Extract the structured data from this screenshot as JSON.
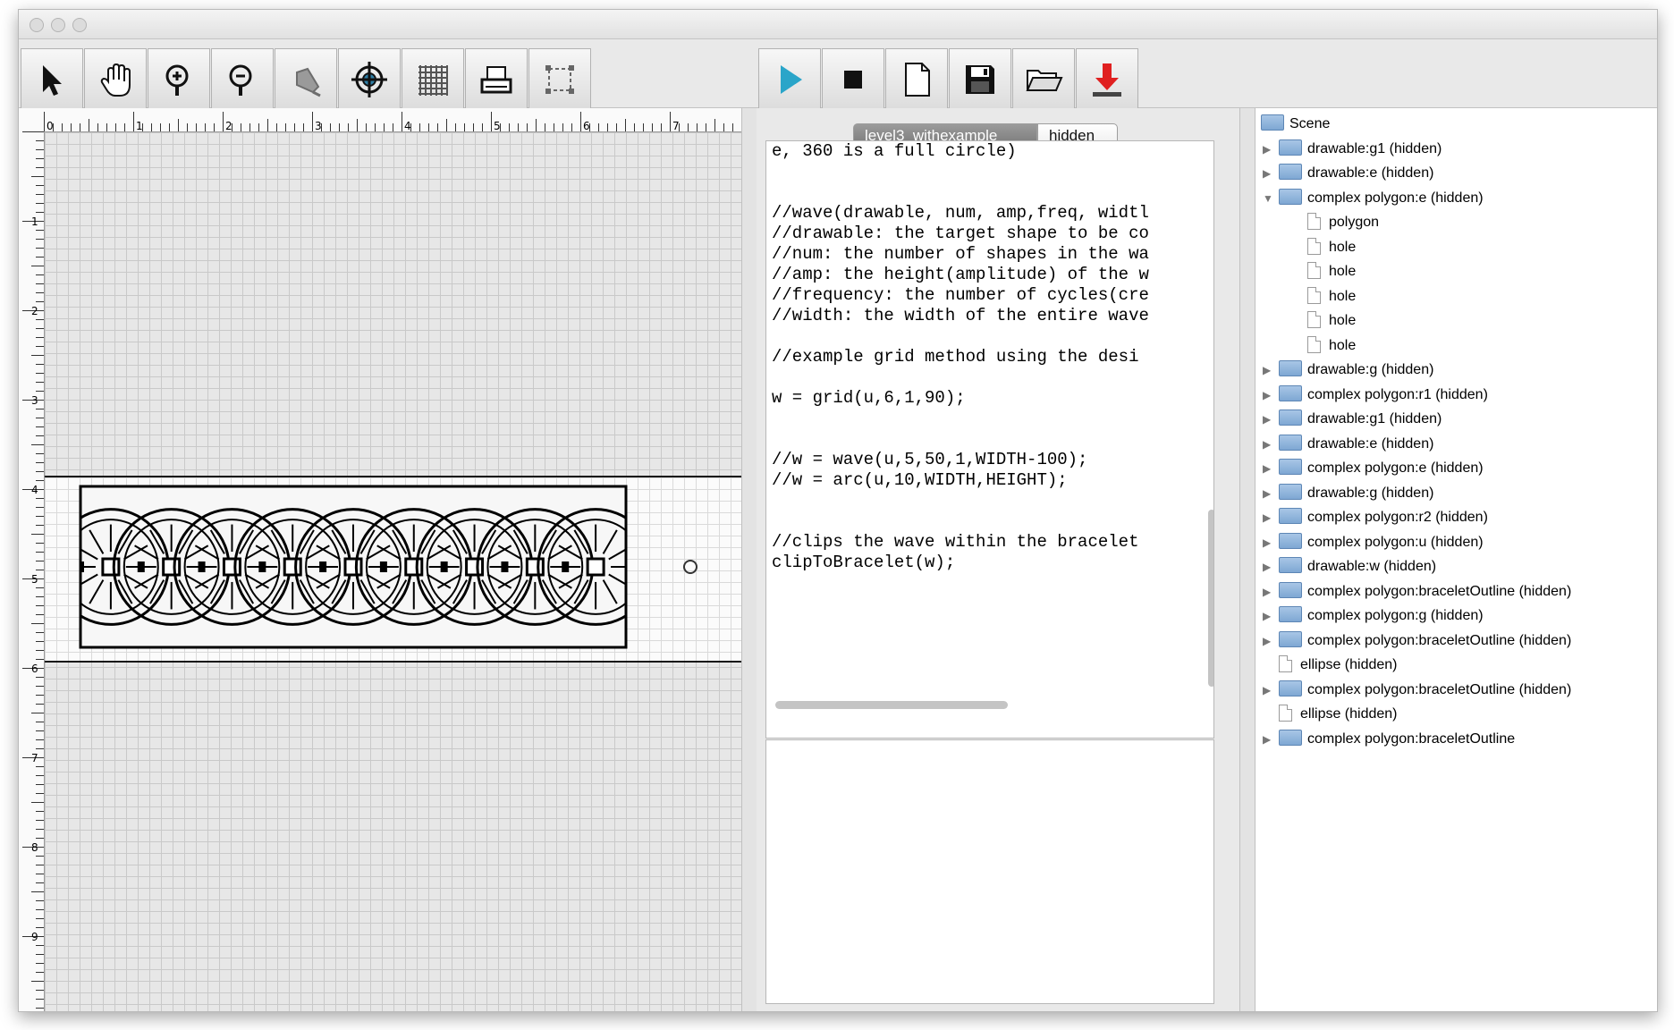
{
  "toolbar_left": [
    {
      "icon": "arrow-pointer-icon",
      "name": "select-tool-button"
    },
    {
      "icon": "hand-icon",
      "name": "pan-tool-button"
    },
    {
      "icon": "zoom-in-icon",
      "name": "zoom-in-button"
    },
    {
      "icon": "zoom-out-icon",
      "name": "zoom-out-button"
    },
    {
      "icon": "pen-icon",
      "name": "pen-tool-button"
    },
    {
      "icon": "target-icon",
      "name": "target-button"
    },
    {
      "icon": "grid-icon",
      "name": "grid-toggle-button"
    },
    {
      "icon": "printer-icon",
      "name": "print-button"
    },
    {
      "icon": "selection-box-icon",
      "name": "selection-box-button"
    }
  ],
  "toolbar_right": [
    {
      "icon": "play-icon",
      "name": "run-button",
      "color": "#2aa5c9"
    },
    {
      "icon": "stop-icon",
      "name": "stop-button",
      "color": "#111111"
    },
    {
      "icon": "new-file-icon",
      "name": "new-file-button"
    },
    {
      "icon": "save-icon",
      "name": "save-button"
    },
    {
      "icon": "open-folder-icon",
      "name": "open-button"
    },
    {
      "icon": "download-icon",
      "name": "export-button",
      "color": "#e02020"
    }
  ],
  "ruler": {
    "top_labels": [
      "0",
      "1",
      "2",
      "3",
      "4",
      "5",
      "6",
      "7"
    ],
    "left_labels": [
      "1",
      "2",
      "3",
      "4",
      "5",
      "6",
      "7",
      "8",
      "9"
    ]
  },
  "editor": {
    "tabs": [
      "level3_withexample",
      "hidden"
    ],
    "code_lines": [
      "e, 360 is a full circle)",
      "",
      "",
      "//wave(drawable, num, amp,freq, widtl",
      "//drawable: the target shape to be co",
      "//num: the number of shapes in the wa",
      "//amp: the height(amplitude) of the w",
      "//frequency: the number of cycles(cre",
      "//width: the width of the entire wave",
      "",
      "//example grid method using the desi",
      "",
      "w = grid(u,6,1,90);",
      "",
      "",
      "//w = wave(u,5,50,1,WIDTH-100);",
      "//w = arc(u,10,WIDTH,HEIGHT);",
      "",
      "",
      "//clips the wave within the bracelet",
      "clipToBracelet(w);"
    ]
  },
  "scene_tree": {
    "root": "Scene",
    "items": [
      {
        "label": "drawable:g1 (hidden)",
        "type": "folder",
        "expander": "▶",
        "indent": 0
      },
      {
        "label": "drawable:e (hidden)",
        "type": "folder",
        "expander": "▶",
        "indent": 0
      },
      {
        "label": "complex polygon:e (hidden)",
        "type": "folder",
        "expander": "▼",
        "indent": 0
      },
      {
        "label": "polygon",
        "type": "file",
        "expander": "",
        "indent": 1
      },
      {
        "label": "hole",
        "type": "file",
        "expander": "",
        "indent": 1
      },
      {
        "label": "hole",
        "type": "file",
        "expander": "",
        "indent": 1
      },
      {
        "label": "hole",
        "type": "file",
        "expander": "",
        "indent": 1
      },
      {
        "label": "hole",
        "type": "file",
        "expander": "",
        "indent": 1
      },
      {
        "label": "hole",
        "type": "file",
        "expander": "",
        "indent": 1
      },
      {
        "label": "drawable:g (hidden)",
        "type": "folder",
        "expander": "▶",
        "indent": 0
      },
      {
        "label": "complex polygon:r1 (hidden)",
        "type": "folder",
        "expander": "▶",
        "indent": 0
      },
      {
        "label": "drawable:g1 (hidden)",
        "type": "folder",
        "expander": "▶",
        "indent": 0
      },
      {
        "label": "drawable:e (hidden)",
        "type": "folder",
        "expander": "▶",
        "indent": 0
      },
      {
        "label": "complex polygon:e (hidden)",
        "type": "folder",
        "expander": "▶",
        "indent": 0
      },
      {
        "label": "drawable:g (hidden)",
        "type": "folder",
        "expander": "▶",
        "indent": 0
      },
      {
        "label": "complex polygon:r2 (hidden)",
        "type": "folder",
        "expander": "▶",
        "indent": 0
      },
      {
        "label": "complex polygon:u (hidden)",
        "type": "folder",
        "expander": "▶",
        "indent": 0
      },
      {
        "label": "drawable:w (hidden)",
        "type": "folder",
        "expander": "▶",
        "indent": 0
      },
      {
        "label": "complex polygon:braceletOutline (hidden)",
        "type": "folder",
        "expander": "▶",
        "indent": 0
      },
      {
        "label": "complex polygon:g (hidden)",
        "type": "folder",
        "expander": "▶",
        "indent": 0
      },
      {
        "label": "complex polygon:braceletOutline (hidden)",
        "type": "folder",
        "expander": "▶",
        "indent": 0
      },
      {
        "label": "ellipse (hidden)",
        "type": "file",
        "expander": "",
        "indent": 0
      },
      {
        "label": "complex polygon:braceletOutline (hidden)",
        "type": "folder",
        "expander": "▶",
        "indent": 0
      },
      {
        "label": "ellipse (hidden)",
        "type": "file",
        "expander": "",
        "indent": 0
      },
      {
        "label": "complex polygon:braceletOutline",
        "type": "folder",
        "expander": "▶",
        "indent": 0
      }
    ]
  }
}
